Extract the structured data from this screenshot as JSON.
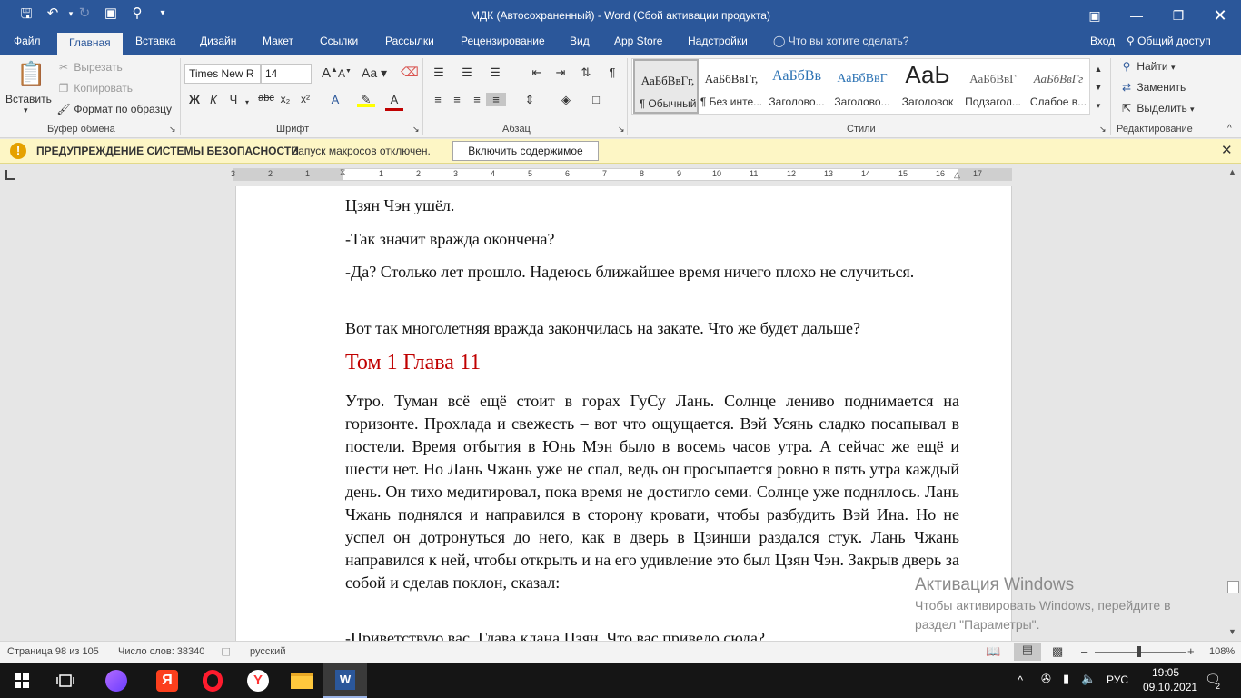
{
  "title_bar": {
    "document_title": "МДК (Автосохраненный) - Word (Сбой активации продукта)",
    "quick_access": [
      "save-icon",
      "undo-icon",
      "redo-icon",
      "touch-mode-icon",
      "search-icon",
      "customize-icon"
    ]
  },
  "tabs": {
    "items": [
      "Файл",
      "Главная",
      "Вставка",
      "Дизайн",
      "Макет",
      "Ссылки",
      "Рассылки",
      "Рецензирование",
      "Вид",
      "App Store",
      "Надстройки"
    ],
    "tell_me": "Что вы хотите сделать?",
    "signin": "Вход",
    "share": "Общий доступ"
  },
  "ribbon": {
    "clipboard": {
      "paste": "Вставить",
      "cut": "Вырезать",
      "copy": "Копировать",
      "format_painter": "Формат по образцу",
      "label": "Буфер обмена"
    },
    "font": {
      "name": "Times New R",
      "size": "14",
      "label": "Шрифт"
    },
    "paragraph": {
      "label": "Абзац"
    },
    "styles": {
      "label": "Стили",
      "items": [
        {
          "preview": "АаБбВвГг,",
          "name": "¶ Обычный"
        },
        {
          "preview": "АаБбВвГг,",
          "name": "¶ Без инте..."
        },
        {
          "preview": "АаБбВв",
          "name": "Заголово..."
        },
        {
          "preview": "АаБбВвГ",
          "name": "Заголово..."
        },
        {
          "preview": "АаЬ",
          "name": "Заголовок"
        },
        {
          "preview": "АаБбВвГ",
          "name": "Подзагол..."
        },
        {
          "preview": "АаБбВвГг",
          "name": "Слабое в..."
        }
      ]
    },
    "editing": {
      "find": "Найти",
      "replace": "Заменить",
      "select": "Выделить",
      "label": "Редактирование"
    }
  },
  "security_bar": {
    "title": "ПРЕДУПРЕЖДЕНИЕ СИСТЕМЫ БЕЗОПАСНОСТИ",
    "message": "Запуск макросов отключен.",
    "button": "Включить содержимое"
  },
  "ruler": {
    "ticks": [
      "3",
      "2",
      "1",
      "1",
      "2",
      "3",
      "4",
      "5",
      "6",
      "7",
      "8",
      "9",
      "10",
      "11",
      "12",
      "13",
      "14",
      "15",
      "16",
      "17"
    ]
  },
  "document": {
    "paragraphs_top": [
      "Цзян Чэн ушёл.",
      "-Так значит вражда окончена?",
      "-Да? Столько лет прошло. Надеюсь ближайшее время ничего плохо не случиться.",
      "Вот так многолетняя вражда закончилась на закате. Что же будет дальше?"
    ],
    "heading": "Том 1 Глава 11",
    "body": "Утро. Туман всё ещё стоит в горах ГуСу Лань. Солнце лениво поднимается на горизонте. Прохлада и свежесть – вот что ощущается. Вэй Усянь сладко посапывал в постели. Время отбытия в Юнь Мэн было в восемь часов утра. А сейчас же ещё и шести нет. Но Лань Чжань уже не спал, ведь он просыпается ровно в пять утра каждый день. Он тихо медитировал, пока время не достигло семи. Солнце уже поднялось. Лань Чжань поднялся и направился в сторону кровати, чтобы разбудить Вэй Ина. Но не успел он дотронуться до него, как в дверь в Цзинши раздался стук. Лань Чжань направился к ней, чтобы открыть и на его удивление это был Цзян Чэн. Закрыв дверь за собой и сделав поклон, сказал:",
    "last_line": "-Приветствую вас, Глава клана Цзян. Что вас привело сюда?"
  },
  "watermark": {
    "line1": "Активация Windows",
    "line2": "Чтобы активировать Windows, перейдите в",
    "line3": "раздел \"Параметры\"."
  },
  "status_bar": {
    "page": "Страница 98 из 105",
    "words": "Число слов: 38340",
    "language": "русский",
    "zoom": "108%",
    "zoom_level": 1.08
  },
  "taskbar": {
    "apps": [
      "start-icon",
      "task-view-icon",
      "alice-icon",
      "yandex-icon",
      "opera-icon",
      "yandex-browser-icon",
      "file-explorer-icon",
      "word-icon"
    ],
    "lang": "РУС",
    "time": "19:05",
    "date": "09.10.2021",
    "notification_count": "2"
  },
  "colors": {
    "accent": "#2b579a",
    "heading": "#c00000",
    "security_bar": "#fdf6c5"
  }
}
